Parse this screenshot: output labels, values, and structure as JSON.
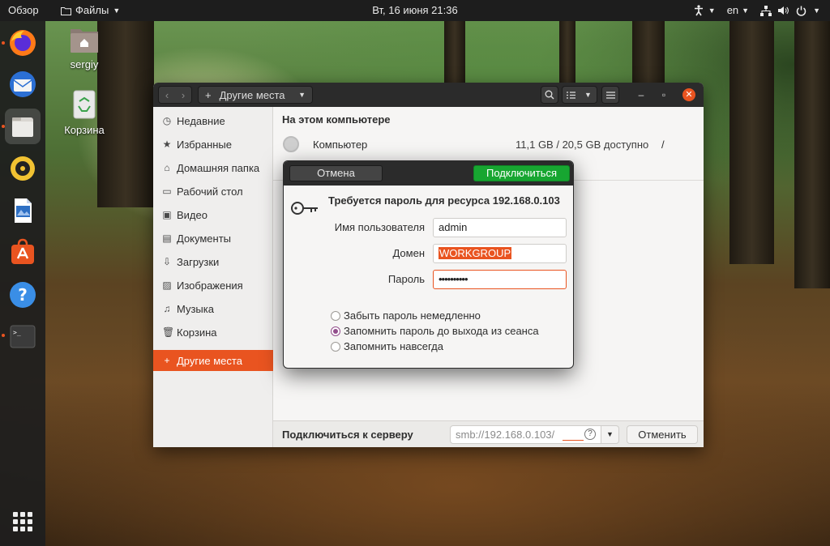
{
  "topbar": {
    "overview": "Обзор",
    "app_menu": "Файлы",
    "clock": "Вт, 16 июня  21:36",
    "lang": "en"
  },
  "dock": {
    "items": [
      "firefox-icon",
      "thunderbird-icon",
      "files-icon",
      "rhythmbox-icon",
      "writer-icon",
      "software-icon",
      "help-icon",
      "terminal-icon"
    ],
    "terminal_text": ">_"
  },
  "desktop": {
    "home_label": "sergiy",
    "trash_label": "Корзина"
  },
  "files_window": {
    "location": "Другие места",
    "sidebar": [
      {
        "icon": "clock-icon",
        "label": "Недавние"
      },
      {
        "icon": "star-icon",
        "label": "Избранные"
      },
      {
        "icon": "home-icon",
        "label": "Домашняя папка"
      },
      {
        "icon": "desktop-icon",
        "label": "Рабочий стол"
      },
      {
        "icon": "video-icon",
        "label": "Видео"
      },
      {
        "icon": "document-icon",
        "label": "Документы"
      },
      {
        "icon": "download-icon",
        "label": "Загрузки"
      },
      {
        "icon": "image-icon",
        "label": "Изображения"
      },
      {
        "icon": "music-icon",
        "label": "Музыка"
      },
      {
        "icon": "trash-icon",
        "label": "Корзина"
      },
      {
        "icon": "plus-icon",
        "label": "Другие места"
      }
    ],
    "section_title": "На этом компьютере",
    "computer": {
      "name": "Компьютер",
      "space": "11,1 GB / 20,5 GB доступно",
      "mount": "/"
    },
    "connect_label": "Подключиться к серверу",
    "server_placeholder": "smb://192.168.0.103/",
    "cancel_btn": "Отменить"
  },
  "password_dialog": {
    "cancel": "Отмена",
    "connect": "Подключиться",
    "title": "Требуется пароль для ресурса 192.168.0.103",
    "username_label": "Имя пользователя",
    "username_value": "admin",
    "domain_label": "Домен",
    "domain_value": "WORKGROUP",
    "password_label": "Пароль",
    "password_value": "••••••••••",
    "options": [
      {
        "label": "Забыть пароль немедленно",
        "selected": false
      },
      {
        "label": "Запомнить пароль до выхода из сеанса",
        "selected": true
      },
      {
        "label": "Запомнить навсегда",
        "selected": false
      }
    ]
  },
  "colors": {
    "accent": "#e95420",
    "connect": "#17a631",
    "radio": "#924d8b",
    "topbar": "#1d1d1d"
  }
}
